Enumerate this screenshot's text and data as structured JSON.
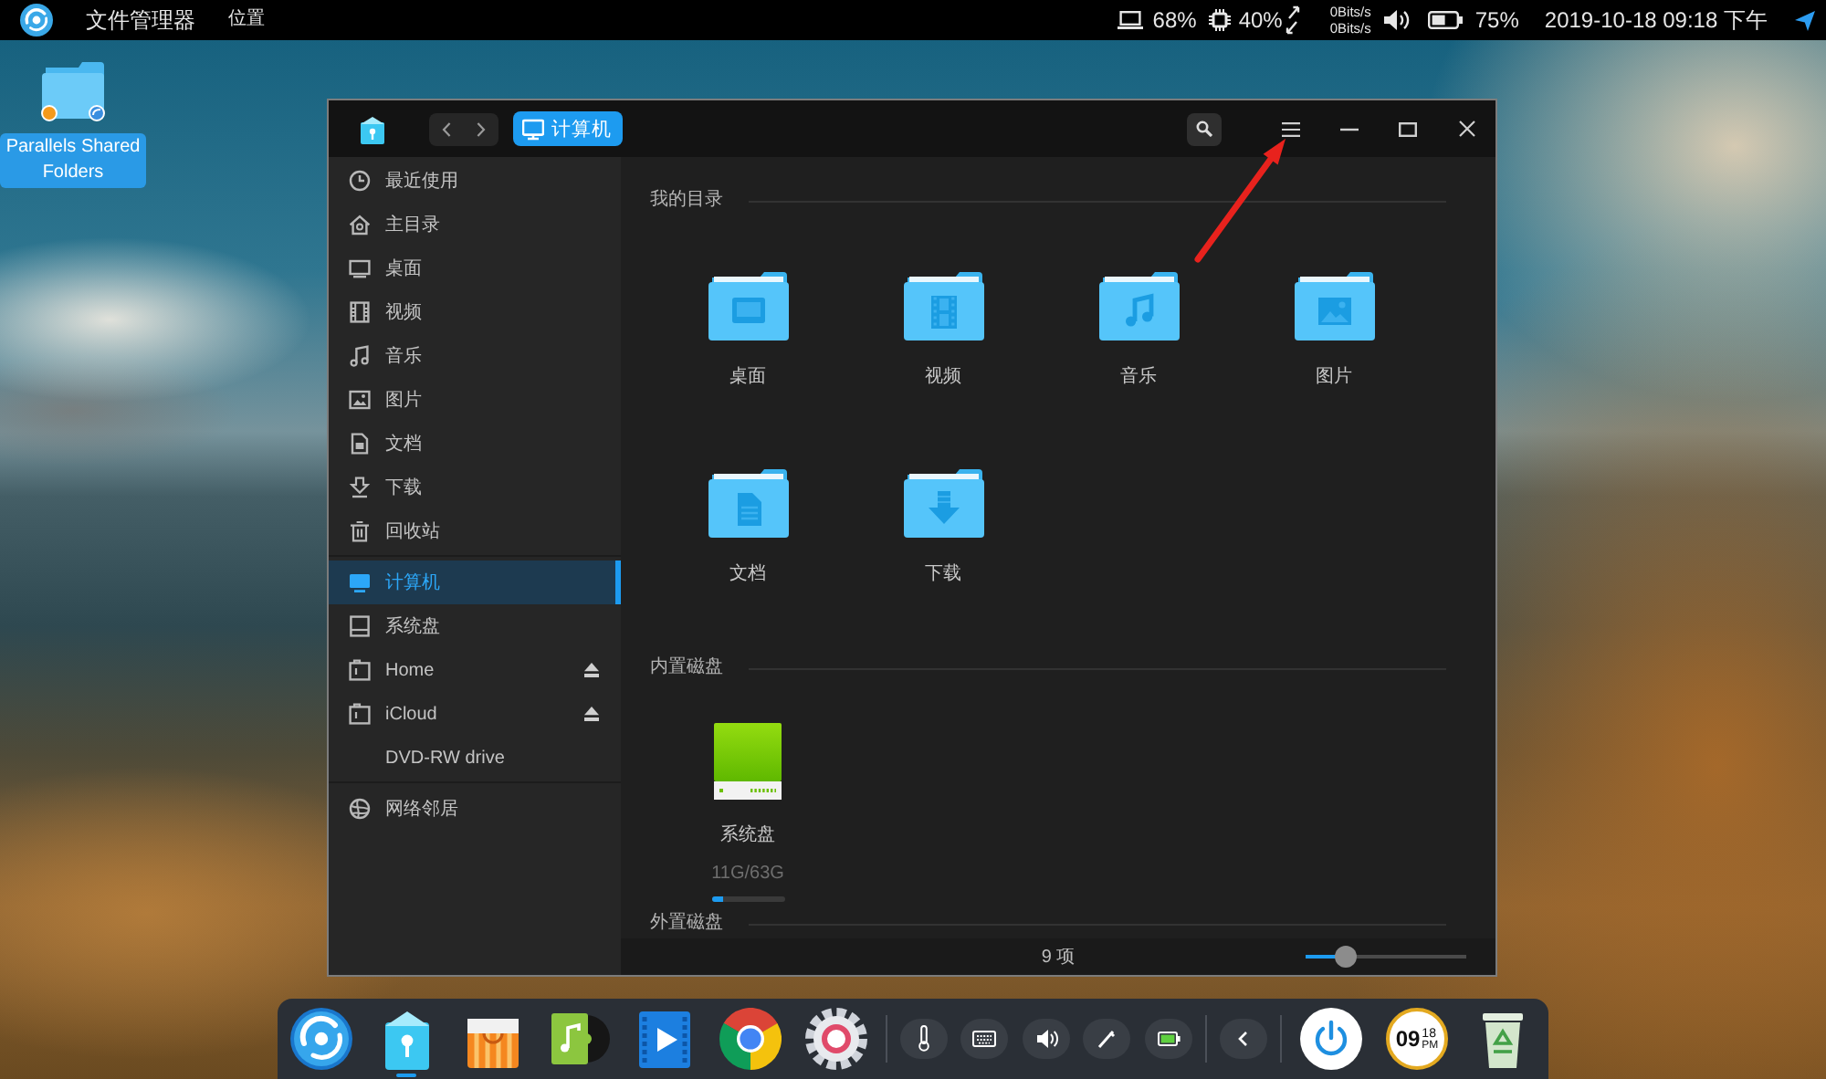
{
  "top_bar": {
    "app_title": "文件管理器",
    "menus": [
      {
        "label": "位置"
      }
    ],
    "laptop_reading": "68%",
    "cpu_reading": "40%",
    "network_speeds": [
      "0Bits/s",
      "0Bits/s"
    ],
    "battery_reading": "75%",
    "datetime": "2019-10-18 09:18 下午"
  },
  "desktop_icons": [
    {
      "label": "Parallels Shared Folders",
      "selected": true
    }
  ],
  "window": {
    "breadcrumb": [
      {
        "label": "计算机",
        "selected": true
      }
    ],
    "sidebar": [
      [
        {
          "label": "最近使用",
          "selected": false,
          "eject": false
        },
        {
          "label": "主目录",
          "selected": false,
          "eject": false
        },
        {
          "label": "桌面",
          "selected": false,
          "eject": false
        },
        {
          "label": "视频",
          "selected": false,
          "eject": false
        },
        {
          "label": "音乐",
          "selected": false,
          "eject": false
        },
        {
          "label": "图片",
          "selected": false,
          "eject": false
        },
        {
          "label": "文档",
          "selected": false,
          "eject": false
        },
        {
          "label": "下载",
          "selected": false,
          "eject": false
        },
        {
          "label": "回收站",
          "selected": false,
          "eject": false
        }
      ],
      [
        {
          "label": "计算机",
          "selected": true,
          "eject": false
        },
        {
          "label": "系统盘",
          "selected": false,
          "eject": false
        },
        {
          "label": "Home",
          "selected": false,
          "eject": true
        },
        {
          "label": "iCloud",
          "selected": false,
          "eject": true
        },
        {
          "label": "DVD-RW drive",
          "selected": false,
          "eject": false
        }
      ],
      [
        {
          "label": "网络邻居",
          "selected": false,
          "eject": false
        }
      ]
    ],
    "sections": [
      {
        "kind": "folders",
        "title": "我的目录",
        "items": [
          {
            "label": "桌面"
          },
          {
            "label": "视频"
          },
          {
            "label": "音乐"
          },
          {
            "label": "图片"
          },
          {
            "label": "文档"
          },
          {
            "label": "下载"
          }
        ]
      },
      {
        "kind": "disks",
        "title": "内置磁盘",
        "items": [
          {
            "label": "系统盘",
            "usage": "11G/63G",
            "level": 0.17
          }
        ]
      },
      {
        "kind": "disks",
        "title": "外置磁盘"
      }
    ],
    "status_bar": {
      "item_count": "9 项",
      "zoom_slider": {
        "level": 0.25
      }
    }
  },
  "dock": {
    "apps": [
      {
        "running": false
      },
      {
        "running": true
      },
      {
        "running": false
      },
      {
        "running": false
      },
      {
        "running": false
      },
      {
        "running": false
      },
      {
        "running": false
      }
    ],
    "clock": {
      "hour": "09",
      "minute": "18",
      "period": "PM"
    }
  }
}
